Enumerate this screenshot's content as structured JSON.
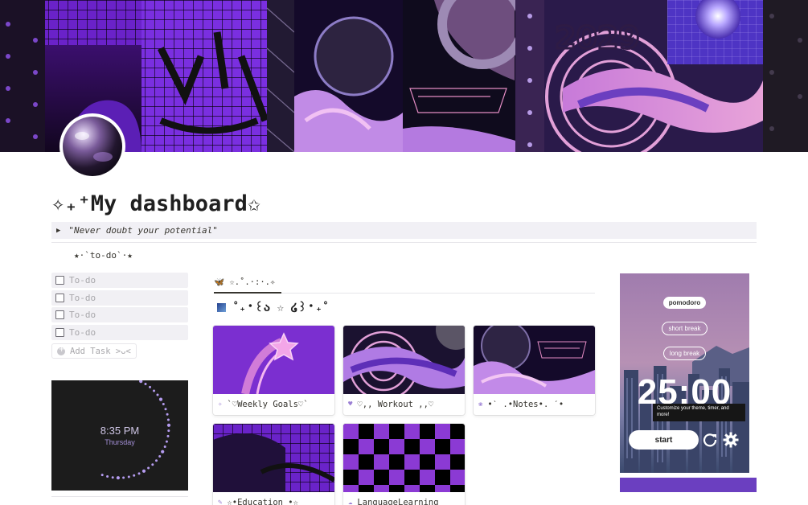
{
  "page": {
    "title": "✧₊⁺My dashboard✩",
    "quote": "\"Never doubt your potential\"",
    "toggle_icon": "triangle-right-icon",
    "todo_heading": "★·`to-do`·★"
  },
  "todos": {
    "items": [
      "To-do",
      "To-do",
      "To-do",
      "To-do"
    ],
    "add_label": "Add Task >ᴗ<"
  },
  "clock": {
    "time": "8:35 PM",
    "day": "Thursday"
  },
  "gallery": {
    "tab_label": "🦋 ☆.˚.·:·.✧",
    "heading": "˚₊‧꒰ა ☆ ໒꒱‧₊˚",
    "cards": [
      {
        "label": "`♡Weekly Goals♡`",
        "icon": "✧"
      },
      {
        "label": "♡,, Workout ,,♡",
        "icon": "♥"
      },
      {
        "label": "•ˋ .•Notes•. ˊ•",
        "icon": "❀"
      },
      {
        "label": "☆•Education •☆",
        "icon": "✎"
      },
      {
        "label": "LanguageLearning",
        "icon": "☁"
      }
    ]
  },
  "pomodoro": {
    "modes": [
      "pomodoro",
      "short break",
      "long break"
    ],
    "active_mode": "pomodoro",
    "timer": "25:00",
    "tooltip": "Customize your theme, timer, and more!",
    "start_label": "start",
    "icons": [
      "reset-icon",
      "settings-gear-icon"
    ]
  },
  "colors": {
    "accent_purple": "#6b3fc0",
    "cover_dark": "#1a0b2e",
    "clock_bg": "#1c1c1c",
    "clock_dots": "#b59cf0"
  }
}
